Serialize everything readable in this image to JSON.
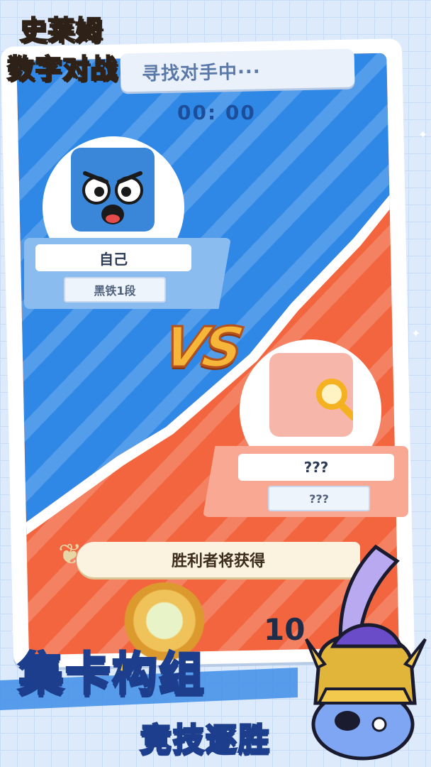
{
  "logo": {
    "line1": "史莱姆",
    "line2": "数字对战"
  },
  "match": {
    "status_text": "寻找对手中···",
    "timer": "00: 00",
    "vs_label": "VS"
  },
  "player_self": {
    "name": "自己",
    "rank": "黑铁1段"
  },
  "player_opponent": {
    "name": "???",
    "rank": "???"
  },
  "reward": {
    "banner_text": "胜利者将获得",
    "count_text": "10"
  },
  "slogan": {
    "part_a": "集卡",
    "part_b": "构组",
    "line2": "竞技逐胜"
  },
  "colors": {
    "blue_side": "#2f88e6",
    "red_side": "#f2653f",
    "accent_yellow": "#f5b63a"
  },
  "icons": {
    "search": "search-icon",
    "angry_face": "angry-face-icon",
    "laurel": "laurel-icon",
    "medal": "medal-icon"
  }
}
